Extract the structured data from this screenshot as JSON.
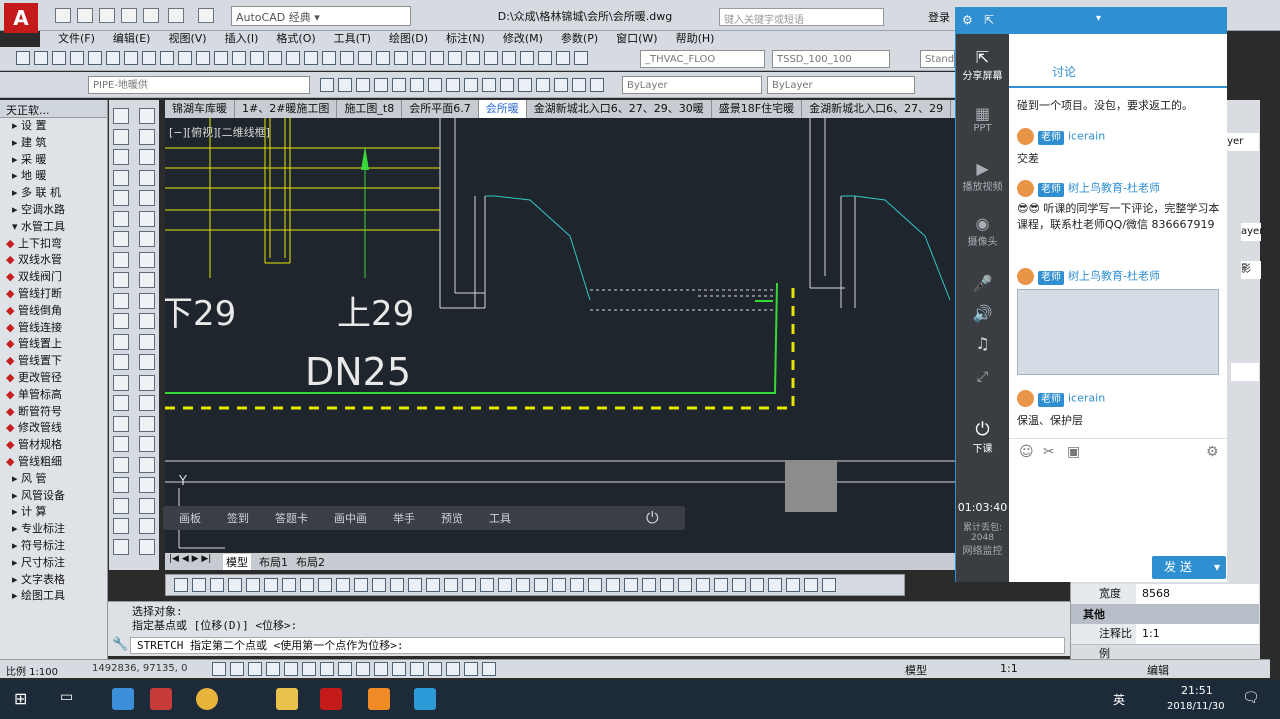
{
  "window": {
    "workspace": "AutoCAD 经典",
    "file_title": "D:\\众成\\格林锦城\\会所\\会所暖.dwg",
    "search_placeholder": "键入关键字或短语",
    "login": "登录"
  },
  "menu": [
    "文件(F)",
    "编辑(E)",
    "视图(V)",
    "插入(I)",
    "格式(O)",
    "工具(T)",
    "绘图(D)",
    "标注(N)",
    "修改(M)",
    "参数(P)",
    "窗口(W)",
    "帮助(H)"
  ],
  "toolbar": {
    "layer_dropdown": "_THVAC_FLOO",
    "style_dropdown": "TSSD_100_100",
    "standard_label": "Stand",
    "layer_current": "PIPE-地暖供",
    "color_bylayer": "ByLayer",
    "linetype_bylayer": "ByLayer"
  },
  "left_panel": {
    "title": "天正软...",
    "items": [
      {
        "label": "设 置",
        "type": "cat"
      },
      {
        "label": "建 筑",
        "type": "cat"
      },
      {
        "label": "采 暖",
        "type": "cat"
      },
      {
        "label": "地 暖",
        "type": "cat"
      },
      {
        "label": "多 联 机",
        "type": "cat"
      },
      {
        "label": "空调水路",
        "type": "cat"
      },
      {
        "label": "水管工具",
        "type": "open"
      },
      {
        "label": "上下扣弯",
        "type": "tool"
      },
      {
        "label": "双线水管",
        "type": "tool"
      },
      {
        "label": "双线阀门",
        "type": "tool"
      },
      {
        "label": "管线打断",
        "type": "tool"
      },
      {
        "label": "管线倒角",
        "type": "tool"
      },
      {
        "label": "管线连接",
        "type": "tool"
      },
      {
        "label": "管线置上",
        "type": "tool"
      },
      {
        "label": "管线置下",
        "type": "tool"
      },
      {
        "label": "更改管径",
        "type": "tool"
      },
      {
        "label": "单管标高",
        "type": "tool"
      },
      {
        "label": "断管符号",
        "type": "tool"
      },
      {
        "label": "修改管线",
        "type": "tool"
      },
      {
        "label": "管材规格",
        "type": "tool"
      },
      {
        "label": "管线粗细",
        "type": "tool"
      },
      {
        "label": "风 管",
        "type": "cat"
      },
      {
        "label": "风管设备",
        "type": "cat"
      },
      {
        "label": "计 算",
        "type": "cat"
      },
      {
        "label": "专业标注",
        "type": "cat"
      },
      {
        "label": "符号标注",
        "type": "cat"
      },
      {
        "label": "尺寸标注",
        "type": "cat"
      },
      {
        "label": "文字表格",
        "type": "cat"
      },
      {
        "label": "绘图工具",
        "type": "cat"
      }
    ]
  },
  "tabs": [
    "锦湖车库暖",
    "1#、2#暖施工图",
    "施工图_t8",
    "会所平面6.7",
    "会所暖",
    "金湖新城北入口6、27、29、30暖",
    "盛景18F住宅暖",
    "金湖新城北入口6、27、29"
  ],
  "active_tab": 4,
  "canvas": {
    "view_label": "[−][俯视][二维线框]",
    "label_down": "下29",
    "label_up": "上29",
    "dn": "DN25",
    "axis_y": "Y"
  },
  "bottom_tools": [
    "画板",
    "签到",
    "答题卡",
    "画中画",
    "举手",
    "预览",
    "工具"
  ],
  "layout_tabs": [
    "模型",
    "布局1",
    "布局2"
  ],
  "command": {
    "line1": "选择对象:",
    "line2": "指定基点或 [位移(D)] <位移>:",
    "prompt": "STRETCH 指定第二个点或 <使用第一个点作为位移>:"
  },
  "status": {
    "scale": "比例 1:100",
    "coords": "1492836, 97135, 0",
    "model": "模型",
    "annotation_scale": "1:1",
    "edit": "编辑"
  },
  "properties": {
    "rows": [
      {
        "k": "宽度",
        "v": "8568"
      }
    ],
    "section": "其他",
    "scale_row": {
      "k": "注释比例",
      "v": "1:1"
    },
    "partial": [
      "ayer",
      "ayer",
      "影"
    ]
  },
  "chat": {
    "tab": "讨论",
    "side": [
      {
        "label": "分享屏幕"
      },
      {
        "label": "PPT"
      },
      {
        "label": "播放视频"
      },
      {
        "label": "摄像头"
      },
      {
        "label": "下课"
      }
    ],
    "time": "01:03:40",
    "stats": "累计丢包: 2048",
    "net": "网络监控",
    "messages": [
      {
        "text": "碰到一个项目。没包，要求返工的。"
      },
      {
        "badge": "老师",
        "name": "icerain",
        "text": "交差"
      },
      {
        "badge": "老师",
        "name": "树上鸟教育-杜老师",
        "text": "😎😎 听课的同学写一下评论，完整学习本课程，联系杜老师QQ/微信 836667919"
      },
      {
        "badge": "老师",
        "name": "树上鸟教育-杜老师",
        "text": ""
      },
      {
        "badge": "老师",
        "name": "icerain",
        "text": "保温、保护层"
      }
    ],
    "send": "发 送"
  },
  "taskbar": {
    "time": "21:51",
    "date": "2018/11/30",
    "ime": "英"
  }
}
